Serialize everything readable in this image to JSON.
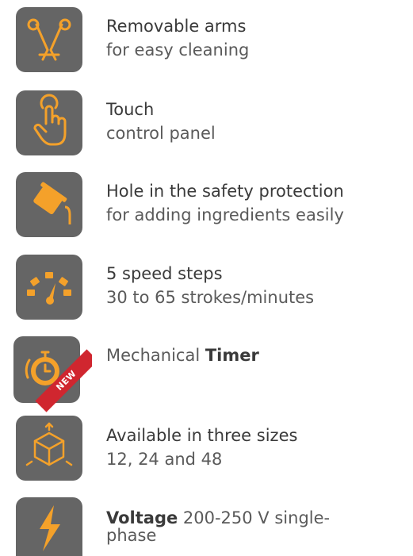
{
  "colors": {
    "tile_bg": "#656565",
    "icon_accent": "#f4a12a",
    "new_badge": "#d0262f"
  },
  "features": [
    {
      "icon": "removable-arms-icon",
      "title": "Removable arms",
      "subtitle": "for easy cleaning"
    },
    {
      "icon": "touch-hand-icon",
      "title": "Touch",
      "subtitle": "control panel"
    },
    {
      "icon": "pouring-ingredients-icon",
      "title": "Hole in the safety protection",
      "subtitle": "for adding ingredients easily"
    },
    {
      "icon": "speedometer-icon",
      "title": "5 speed steps",
      "subtitle": "30 to 65 strokes/minutes"
    },
    {
      "icon": "timer-icon",
      "title_prefix": "Mechanical ",
      "title_bold": "Timer",
      "badge": "NEW"
    },
    {
      "icon": "size-cube-icon",
      "title": "Available in three sizes",
      "subtitle": "12, 24 and 48"
    },
    {
      "icon": "lightning-bolt-icon",
      "title_bold": "Voltage",
      "title_rest": " 200-250 V single-",
      "subtitle": "phase"
    }
  ]
}
